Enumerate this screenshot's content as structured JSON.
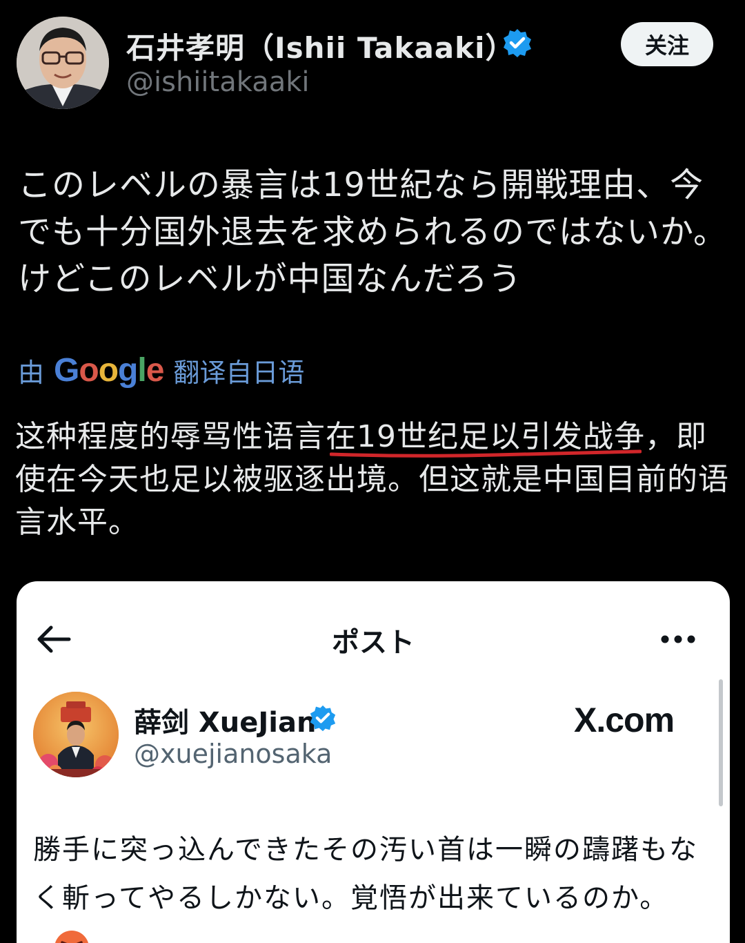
{
  "author": {
    "display_name": "石井孝明（Ishii Takaaki）",
    "handle": "@ishiitakaaki",
    "follow_label": "关注"
  },
  "post": {
    "text": "このレベルの暴言は19世紀なら開戦理由、今でも十分国外退去を求められるのではないか。けどこのレベルが中国なんだろう"
  },
  "translation": {
    "prefix": "由",
    "provider": "Google",
    "suffix": "翻译自日语",
    "text_before": "这种程度的辱骂性语言",
    "text_underlined": "在19世纪足以引发战争",
    "text_after": "，即使在今天也足以被驱逐出境。但这就是中国目前的语言水平。",
    "underline_color": "#d0262a"
  },
  "embedded_post": {
    "header_title": "ポスト",
    "author_name": "薛剑 XueJian",
    "author_handle": "@xuejianosaka",
    "watermark": "X.com",
    "text": "勝手に突っ込んできたその汚い首は一瞬の躊躇もなく斬ってやるしかない。覚悟が出来ているのか。"
  },
  "colors": {
    "background": "#000000",
    "verified": "#1d9bf0",
    "translate_link": "#6a9bd8"
  },
  "icons": [
    "verified-badge-icon",
    "back-arrow-icon",
    "more-options-icon",
    "angry-face-emoji-icon"
  ]
}
